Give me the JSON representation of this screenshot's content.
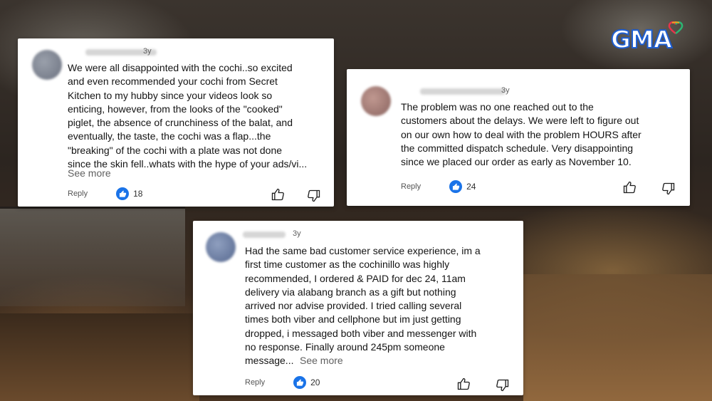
{
  "logo": {
    "text": "GMA",
    "brand_color": "#1f5fd1",
    "heart_colors": [
      "#e8334a",
      "#f2a31b",
      "#2bb673"
    ]
  },
  "comments": [
    {
      "age": "3y",
      "text": "We were all disappointed with the cochi..so excited\nand even recommended your cochi from Secret\nKitchen to my hubby since your videos look so\nenticing, however, from the looks of the \"cooked\"\npiglet, the absence of crunchiness of the balat, and\neventually, the taste, the cochi was a flap...the\n\"breaking\" of the cochi with a plate was not done\nsince the skin fell..whats with the hype of your ads/vi...",
      "see_more": "See more",
      "reply": "Reply",
      "likes": "18"
    },
    {
      "age": "3y",
      "text": "The problem was no one reached out to the\ncustomers about the delays. We were left to figure out\non our own how to deal with the problem HOURS after\nthe committed dispatch schedule. Very disappointing\nsince we placed our order as early as November 10.",
      "see_more": "",
      "reply": "Reply",
      "likes": "24"
    },
    {
      "age": "3y",
      "text": "Had the same bad customer service experience, im a\nfirst time customer as the cochinillo was highly\nrecommended, I ordered & PAID for dec 24, 11am\ndelivery via alabang branch as a gift but nothing\narrived nor advise provided. I tried calling several\ntimes both viber and cellphone but im just getting\ndropped, i messaged both viber and messenger with\nno response. Finally around 245pm someone\nmessage...",
      "see_more": "See more",
      "reply": "Reply",
      "likes": "20"
    }
  ],
  "icons": {
    "like_bubble": "thumbs-up-filled-icon",
    "like": "thumbs-up-outline-icon",
    "dislike": "thumbs-down-outline-icon"
  },
  "colors": {
    "like_blue": "#1a73e8",
    "card_bg": "#ffffff",
    "meta_gray": "#606060"
  }
}
